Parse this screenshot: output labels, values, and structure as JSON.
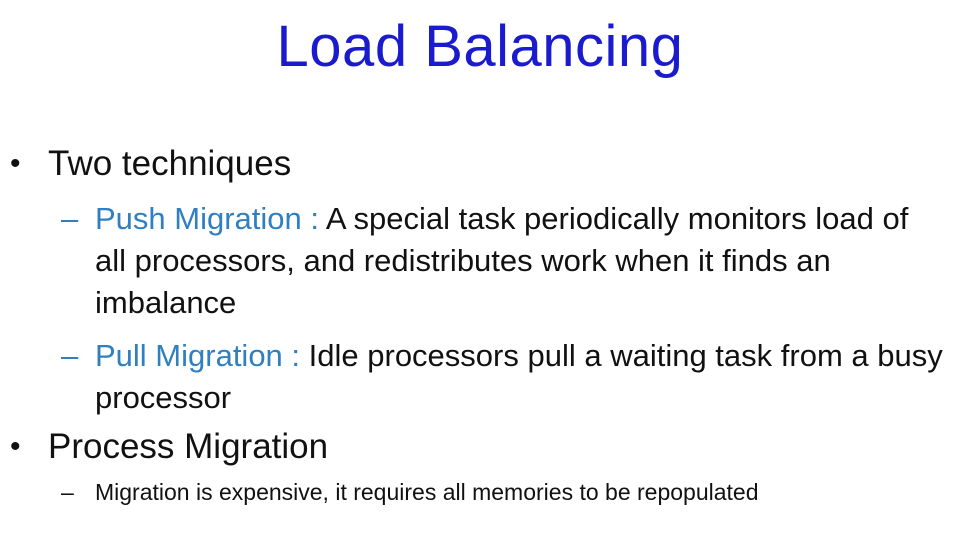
{
  "title": "Load Balancing",
  "bullets": [
    {
      "text": "Two techniques",
      "subitems": [
        {
          "term": "Push Migration :",
          "text": "A special task periodically monitors load of all processors, and redistributes work when it finds an imbalance"
        },
        {
          "term": "Pull Migration :",
          "text": "Idle processors pull a waiting task from a busy processor"
        }
      ]
    },
    {
      "text": "Process Migration",
      "subitems": [
        {
          "text": "Migration is expensive, it requires all memories to be repopulated"
        }
      ]
    }
  ],
  "colors": {
    "title": "#1a1acf",
    "term": "#2f7fc1",
    "body": "#111111"
  },
  "markers": {
    "bullet": "•",
    "dash": "–"
  }
}
